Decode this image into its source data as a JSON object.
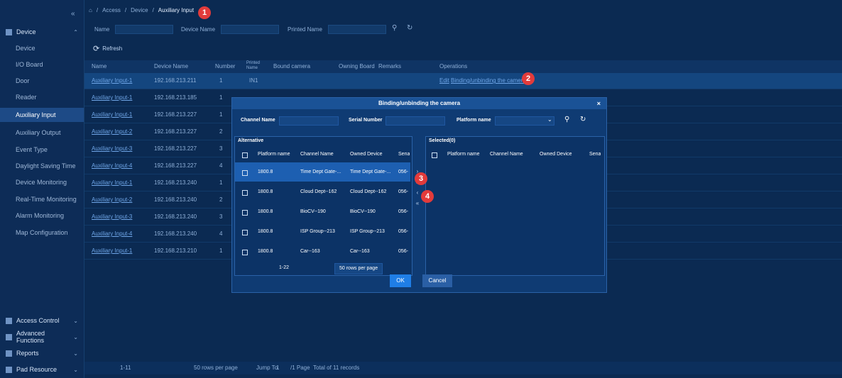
{
  "sidebar": {
    "collapse": "«",
    "device_group": "Device",
    "items": [
      "Device",
      "I/O Board",
      "Door",
      "Reader",
      "Auxiliary Input",
      "Auxiliary Output",
      "Event Type",
      "Daylight Saving Time",
      "Device Monitoring",
      "Real-Time Monitoring",
      "Alarm Monitoring",
      "Map Configuration"
    ],
    "bottom_groups": [
      "Access Control",
      "Advanced Functions",
      "Reports",
      "Pad Resource"
    ]
  },
  "breadcrumb": {
    "home": "⌂",
    "sep": "/",
    "p1": "Access",
    "p2": "Device",
    "current": "Auxiliary Input"
  },
  "filters": {
    "name": "Name",
    "device_name": "Device Name",
    "printed_name": "Printed Name"
  },
  "toolbar": {
    "refresh": "Refresh"
  },
  "table": {
    "headers": [
      "Name",
      "Device Name",
      "Number",
      "Printed Name",
      "Bound camera",
      "Owning Board",
      "Remarks",
      "Operations"
    ],
    "rows": [
      {
        "name": "Auxiliary Input-1",
        "device": "192.168.213.211",
        "number": "1",
        "printed": "IN1"
      },
      {
        "name": "Auxiliary Input-1",
        "device": "192.168.213.185",
        "number": "1",
        "printed": ""
      },
      {
        "name": "Auxiliary Input-1",
        "device": "192.168.213.227",
        "number": "1",
        "printed": ""
      },
      {
        "name": "Auxiliary Input-2",
        "device": "192.168.213.227",
        "number": "2",
        "printed": ""
      },
      {
        "name": "Auxiliary Input-3",
        "device": "192.168.213.227",
        "number": "3",
        "printed": ""
      },
      {
        "name": "Auxiliary Input-4",
        "device": "192.168.213.227",
        "number": "4",
        "printed": ""
      },
      {
        "name": "Auxiliary Input-1",
        "device": "192.168.213.240",
        "number": "1",
        "printed": ""
      },
      {
        "name": "Auxiliary Input-2",
        "device": "192.168.213.240",
        "number": "2",
        "printed": ""
      },
      {
        "name": "Auxiliary Input-3",
        "device": "192.168.213.240",
        "number": "3",
        "printed": ""
      },
      {
        "name": "Auxiliary Input-4",
        "device": "192.168.213.240",
        "number": "4",
        "printed": ""
      },
      {
        "name": "Auxiliary Input-1",
        "device": "192.168.213.210",
        "number": "1",
        "printed": ""
      }
    ],
    "op_edit": "Edit",
    "op_bind": "Binding/unbinding the camera"
  },
  "pager": {
    "range": "1-11",
    "per_page": "50 rows per page",
    "jump_to": "Jump To",
    "page_num": "1",
    "pages": "/1 Page",
    "total": "Total of 11 records"
  },
  "modal": {
    "title": "Binding/unbinding the camera",
    "close": "×",
    "filter_channel": "Channel Name",
    "filter_serial": "Serial Number",
    "filter_platform": "Platform name",
    "alt_title": "Alternative",
    "sel_title": "Selected(0)",
    "alt_headers": [
      "Platform name",
      "Channel Name",
      "Owned Device",
      "Serial Number"
    ],
    "sel_headers": [
      "Platform name",
      "Channel Name",
      "Owned Device",
      "Serial Number"
    ],
    "alt_rows": [
      {
        "platform": "1800.8",
        "channel": "Time Dept Gate-...",
        "device": "Time Dept Gate-...",
        "serial": "056-"
      },
      {
        "platform": "1800.8",
        "channel": "Cloud Dept--162",
        "device": "Cloud Dept--162",
        "serial": "056-"
      },
      {
        "platform": "1800.8",
        "channel": "BioCV--190",
        "device": "BioCV--190",
        "serial": "056-"
      },
      {
        "platform": "1800.8",
        "channel": "ISP Group--213",
        "device": "ISP Group--213",
        "serial": "056-"
      },
      {
        "platform": "1800.8",
        "channel": "Car--163",
        "device": "Car--163",
        "serial": "056-"
      }
    ],
    "alt_range": "1-22",
    "alt_per_page": "50 rows per page",
    "ok": "OK",
    "cancel": "Cancel"
  },
  "badges": [
    "1",
    "2",
    "3",
    "4"
  ]
}
